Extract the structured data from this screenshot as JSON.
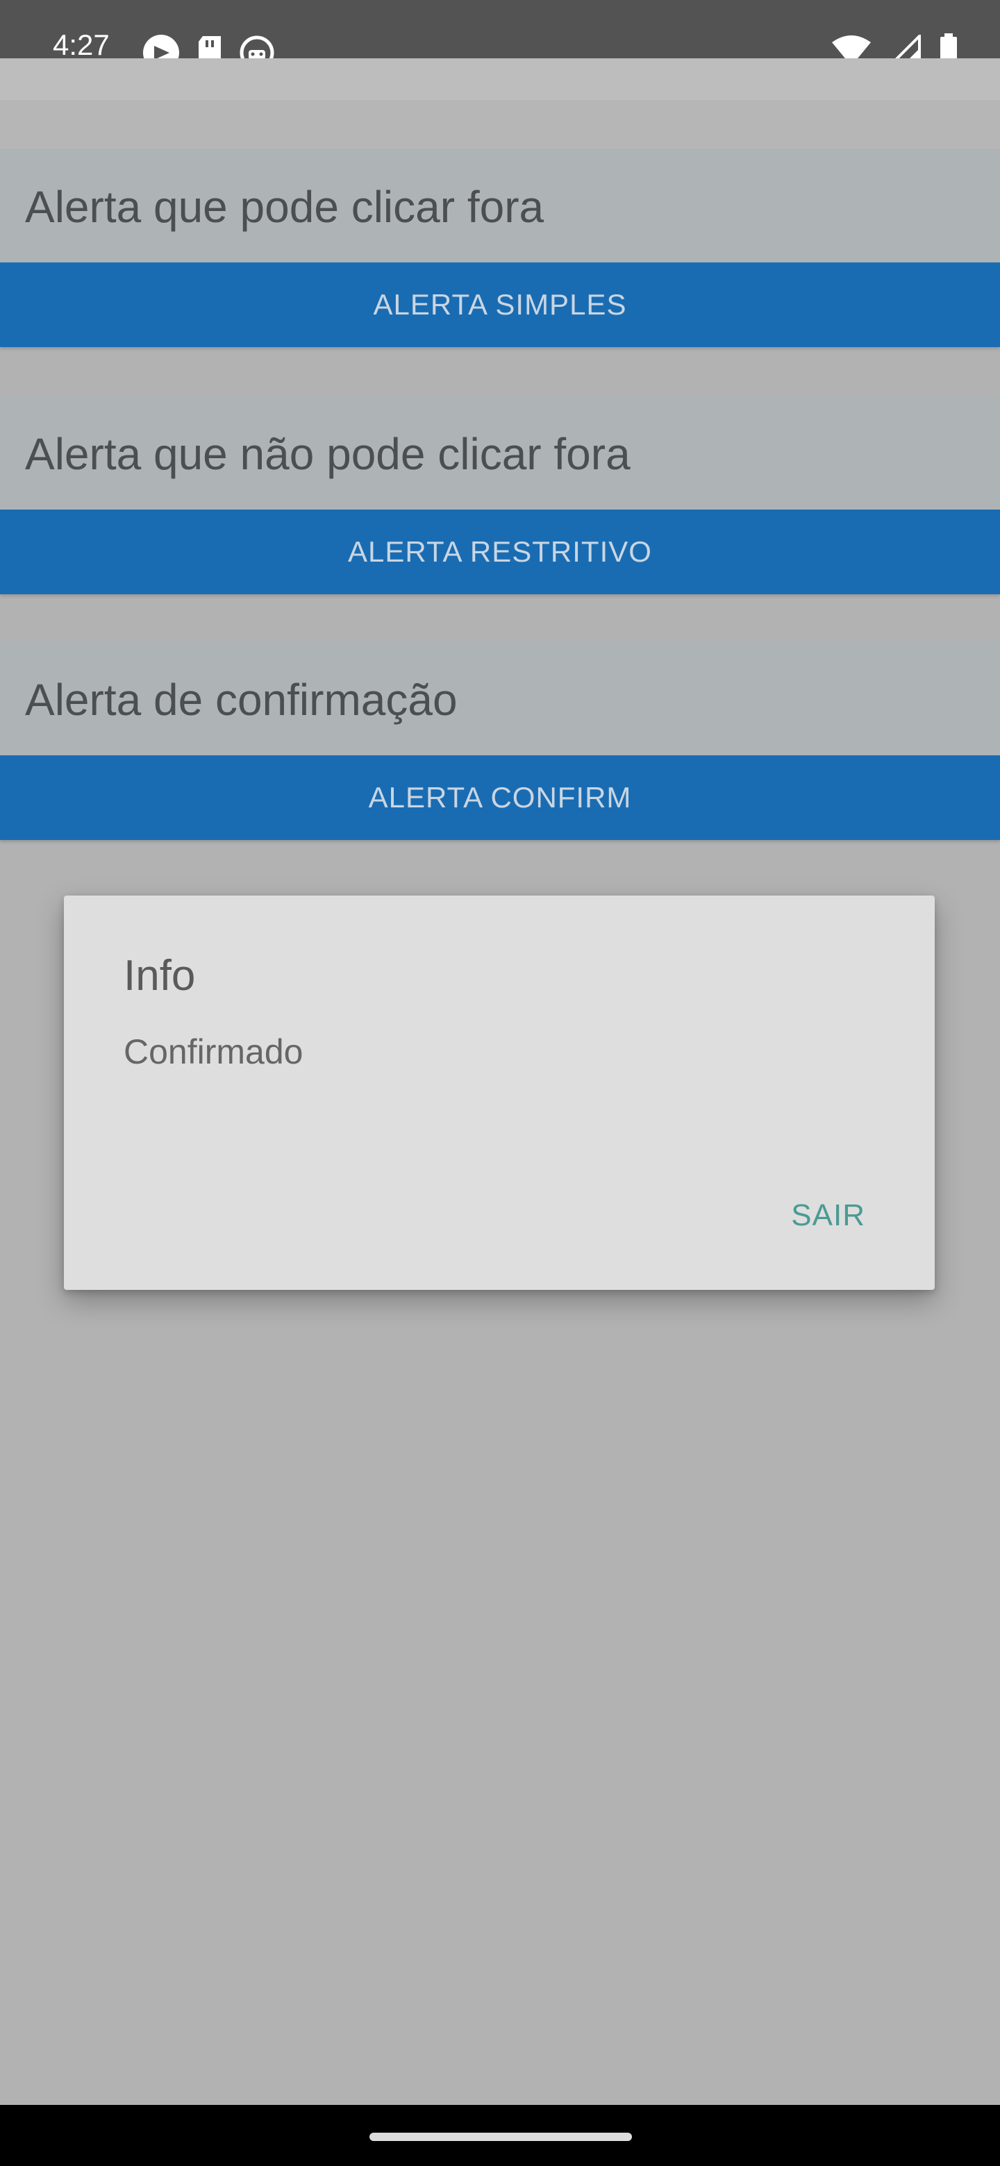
{
  "status_bar": {
    "time": "4:27",
    "left_icons": [
      "media-sync-icon",
      "sd-card-icon",
      "android-debug-icon"
    ],
    "right_icons": [
      "wifi-icon",
      "cell-signal-icon",
      "battery-icon"
    ]
  },
  "sections": [
    {
      "label": "Alerta que pode clicar fora",
      "button": "ALERTA SIMPLES"
    },
    {
      "label": "Alerta que não pode clicar fora",
      "button": "ALERTA RESTRITIVO"
    },
    {
      "label": "Alerta de confirmação",
      "button": "ALERTA CONFIRM"
    }
  ],
  "dialog": {
    "title": "Info",
    "message": "Confirmado",
    "button": "SAIR"
  },
  "colors": {
    "accent_button": "#1a6cb2",
    "dialog_action": "#4a9b92",
    "scrim": "#b2b2b2"
  }
}
